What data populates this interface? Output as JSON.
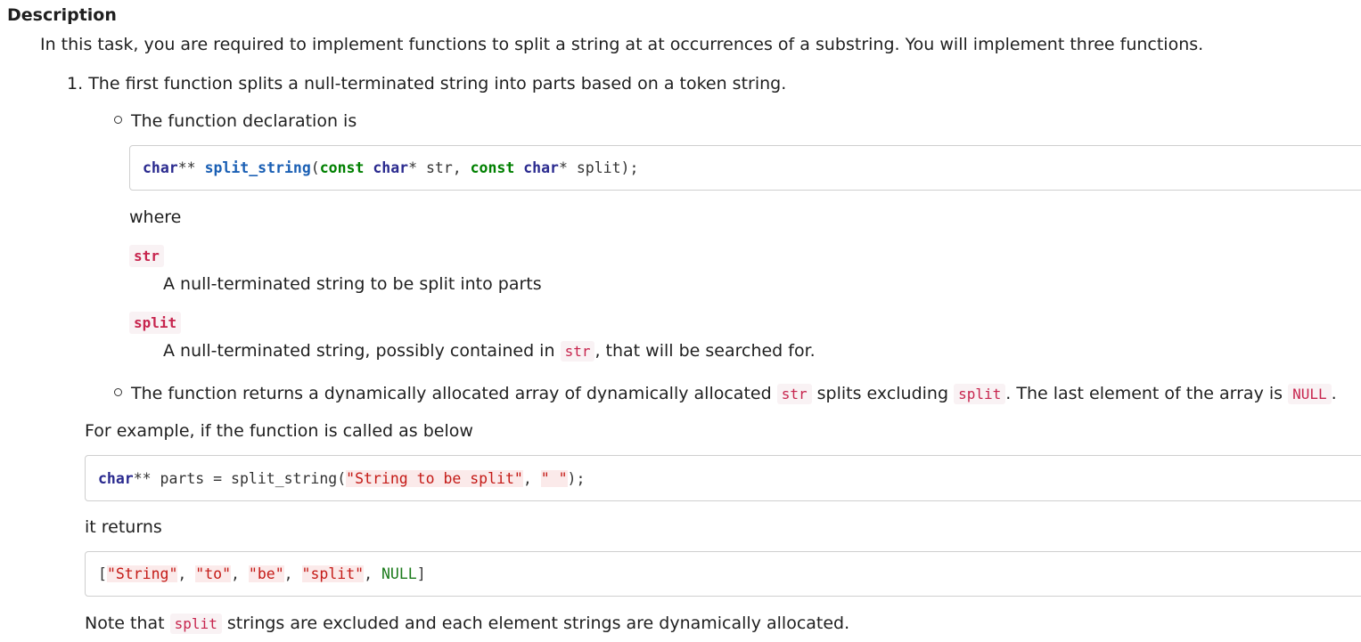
{
  "heading": "Description",
  "intro": "In this task, you are required to implement functions to split a string at at occurrences of a substring. You will implement three functions.",
  "item1_number": "1.",
  "item1_text": "The first function splits a null-terminated string into parts based on a token string.",
  "bullet1_text": "The function declaration is",
  "decl": {
    "t1": "char",
    "t2": "** ",
    "fn": "split_string",
    "t3": "(",
    "c1": "const",
    "t4": " ",
    "t5": "char",
    "t6": "* str, ",
    "c2": "const",
    "t7": " ",
    "t8": "char",
    "t9": "* split);"
  },
  "where": "where",
  "term_str": "str",
  "desc_str": "A null-terminated string to be split into parts",
  "term_split": "split",
  "desc_split_a": "A null-terminated string, possibly contained in",
  "desc_split_code": "str",
  "desc_split_b": ", that will be searched for.",
  "bullet2_a": "The function returns a dynamically allocated array of dynamically allocated",
  "bullet2_code1": "str",
  "bullet2_b": "splits excluding",
  "bullet2_code2": "split",
  "bullet2_c": ". The last element of the array is",
  "bullet2_code3": "NULL",
  "bullet2_d": ".",
  "example_intro": "For example, if the function is called as below",
  "example": {
    "t1": "char",
    "t2": "** parts = split_string(",
    "s1": "\"String to be split\"",
    "t3": ", ",
    "s2": "\" \"",
    "t4": ");"
  },
  "returns_text": "it returns",
  "result": {
    "open": "[",
    "s1": "\"String\"",
    "sep1": ", ",
    "s2": "\"to\"",
    "sep2": ", ",
    "s3": "\"be\"",
    "sep3": ", ",
    "s4": "\"split\"",
    "sep4": ", ",
    "null": "NULL",
    "close": "]"
  },
  "note_a": "Note that",
  "note_code": "split",
  "note_b": "strings are excluded and each element strings are dynamically allocated."
}
